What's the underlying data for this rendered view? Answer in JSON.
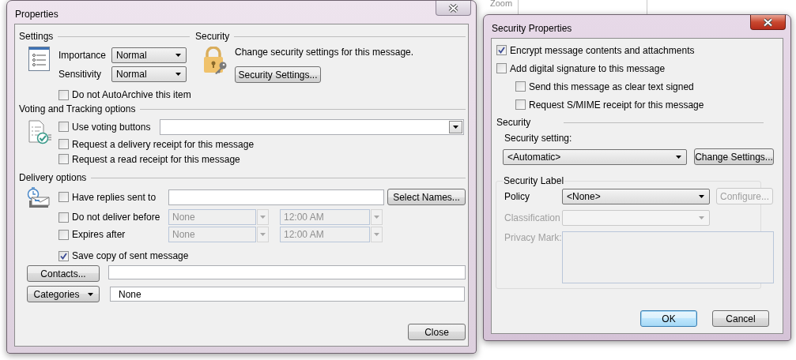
{
  "background": {
    "ribbon_label": "Zoom"
  },
  "properties_dialog": {
    "title": "Properties",
    "active": false,
    "settings": {
      "heading": "Settings",
      "importance": {
        "label": "Importance",
        "value": "Normal"
      },
      "sensitivity": {
        "label": "Sensitivity",
        "value": "Normal"
      },
      "autoarchive": {
        "label": "Do not AutoArchive this item",
        "checked": false
      }
    },
    "security": {
      "heading": "Security",
      "description": "Change security settings for this message.",
      "button": "Security Settings..."
    },
    "voting": {
      "heading": "Voting and Tracking options",
      "options": [
        {
          "label": "Use voting buttons",
          "checked": false
        },
        {
          "label": "Request a delivery receipt for this message",
          "checked": false
        },
        {
          "label": "Request a read receipt for this message",
          "checked": false
        }
      ]
    },
    "delivery": {
      "heading": "Delivery options",
      "replies": {
        "label": "Have replies sent to",
        "checked": false,
        "button": "Select Names..."
      },
      "schedule": [
        {
          "label": "Do not deliver before",
          "checked": false,
          "date": "None",
          "time": "12:00 AM",
          "disabled": true
        },
        {
          "label": "Expires after",
          "checked": false,
          "date": "None",
          "time": "12:00 AM",
          "disabled": true
        }
      ],
      "save_copy": {
        "label": "Save copy of sent message",
        "checked": true
      }
    },
    "contacts": {
      "button": "Contacts..."
    },
    "categories": {
      "button": "Categories",
      "value": "None"
    },
    "close_button": "Close"
  },
  "security_dialog": {
    "title": "Security Properties",
    "active": true,
    "options": [
      {
        "label": "Encrypt message contents and attachments",
        "checked": true
      },
      {
        "label": "Add digital signature to this message",
        "checked": false,
        "children": [
          {
            "label": "Send this message as clear text signed",
            "checked": false
          },
          {
            "label": "Request S/MIME receipt for this message",
            "checked": false
          }
        ]
      }
    ],
    "security": {
      "heading": "Security",
      "setting_label": "Security setting:",
      "setting_value": "<Automatic>",
      "change_button": "Change Settings..."
    },
    "label_group": {
      "heading": "Security Label",
      "policy": {
        "label": "Policy",
        "value": "<None>",
        "disabled": false
      },
      "configure_button": {
        "label": "Configure...",
        "disabled": true
      },
      "classification": {
        "label": "Classification",
        "disabled": true
      },
      "privacy_mark": {
        "label": "Privacy Mark:",
        "disabled": true
      }
    },
    "buttons": [
      {
        "label": "OK",
        "default": true
      },
      {
        "label": "Cancel",
        "default": false
      }
    ]
  }
}
